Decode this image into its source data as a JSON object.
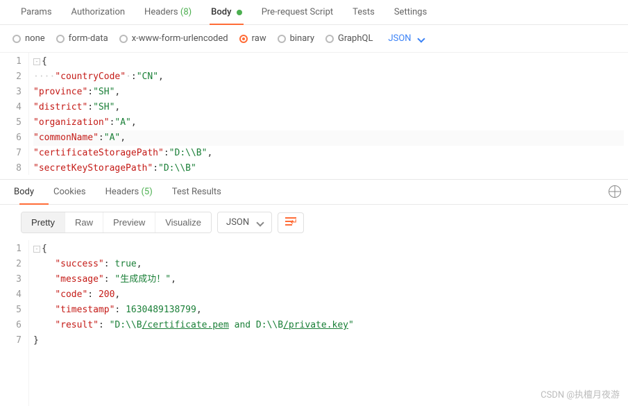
{
  "tabs": {
    "params": "Params",
    "authorization": "Authorization",
    "headers_label": "Headers",
    "headers_count": "(8)",
    "body": "Body",
    "prerequest": "Pre-request Script",
    "tests": "Tests",
    "settings": "Settings"
  },
  "bodyTypes": {
    "none": "none",
    "formdata": "form-data",
    "urlencoded": "x-www-form-urlencoded",
    "raw": "raw",
    "binary": "binary",
    "graphql": "GraphQL"
  },
  "rawType": "JSON",
  "requestEditor": {
    "lines": [
      "1",
      "2",
      "3",
      "4",
      "5",
      "6",
      "7",
      "8"
    ],
    "l2_key": "\"countryCode\"",
    "l2_val": "\"CN\"",
    "l3_key": "\"province\"",
    "l3_val": "\"SH\"",
    "l4_key": "\"district\"",
    "l4_val": "\"SH\"",
    "l5_key": "\"organization\"",
    "l5_val": "\"A\"",
    "l6_key": "\"commonName\"",
    "l6_val": "\"A\"",
    "l7_key": "\"certificateStoragePath\"",
    "l7_val": "\"D:\\\\B\"",
    "l8_key": "\"secretKeyStoragePath\"",
    "l8_val": "\"D:\\\\B\""
  },
  "responseTabs": {
    "body": "Body",
    "cookies": "Cookies",
    "headers_label": "Headers",
    "headers_count": "(5)",
    "test_results": "Test Results"
  },
  "viewModes": {
    "pretty": "Pretty",
    "raw": "Raw",
    "preview": "Preview",
    "visualize": "Visualize"
  },
  "responseFormat": "JSON",
  "responseEditor": {
    "lines": [
      "1",
      "2",
      "3",
      "4",
      "5",
      "6",
      "7"
    ],
    "open_brace": "{",
    "close_brace": "}",
    "success_key": "\"success\"",
    "success_val": "true",
    "message_key": "\"message\"",
    "message_val": "\"生成成功！\"",
    "code_key": "\"code\"",
    "code_val": "200",
    "timestamp_key": "\"timestamp\"",
    "timestamp_val": "1630489138799",
    "result_key": "\"result\"",
    "result_val_p1": "\"D:\\\\B",
    "result_val_p2": "/certificate.pem",
    "result_val_p3": " and D:\\\\B",
    "result_val_p4": "/private.key",
    "result_val_p5": "\""
  },
  "watermark": "CSDN @执檀月夜游"
}
